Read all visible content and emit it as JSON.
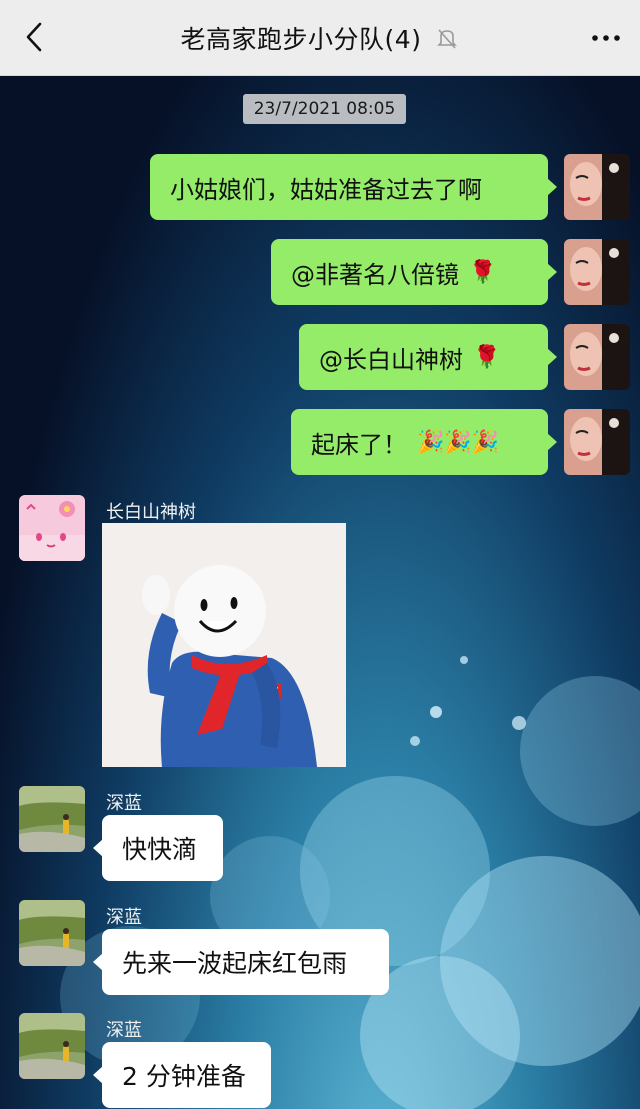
{
  "header": {
    "title": "老高家跑步小分队(4)"
  },
  "chat": {
    "timestamp": "23/7/2021 08:05",
    "outgoing": [
      {
        "text": "小姑娘们，姑姑准备过去了啊",
        "emoji": ""
      },
      {
        "text": "@非著名八倍镜",
        "emoji": "🌹"
      },
      {
        "text": "@长白山神树",
        "emoji": "🌹"
      },
      {
        "text": "起床了！",
        "emoji": "🎉🎉🎉"
      }
    ],
    "incoming": [
      {
        "sender": "长白山神树",
        "type": "image"
      },
      {
        "sender": "深蓝",
        "text": "快快滴"
      },
      {
        "sender": "深蓝",
        "text": "先来一波起床红包雨"
      },
      {
        "sender": "深蓝",
        "text": "2 分钟准备"
      }
    ]
  },
  "icons": {
    "back": "back-arrow-icon",
    "mute": "muted-bell-icon",
    "more": "more-dots-icon"
  },
  "colors": {
    "header_bg": "#ededed",
    "outgoing_bubble": "#95ec69",
    "incoming_bubble": "#ffffff",
    "timestamp_bg": "#b9bcc0"
  }
}
